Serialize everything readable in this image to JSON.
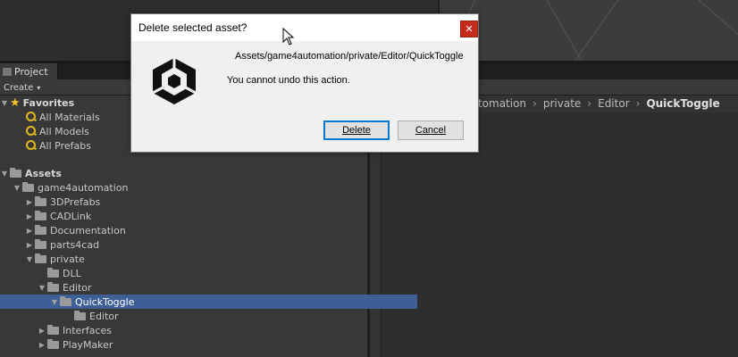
{
  "project_tab": {
    "label": "Project"
  },
  "toolbar": {
    "create_label": "Create",
    "create_arrow": "▾"
  },
  "breadcrumb": {
    "items": [
      "automation",
      "private",
      "Editor"
    ],
    "current": "QuickToggle",
    "separator": "›"
  },
  "tree": {
    "favorites": {
      "label": "Favorites",
      "items": [
        "All Materials",
        "All Models",
        "All Prefabs"
      ]
    },
    "assets": {
      "label": "Assets"
    },
    "game4automation": "game4automation",
    "children": [
      "3DPrefabs",
      "CADLink",
      "Documentation",
      "parts4cad"
    ],
    "private": "private",
    "dll": "DLL",
    "editor": "Editor",
    "quicktoggle": "QuickToggle",
    "quicktoggle_editor": "Editor",
    "interfaces": "Interfaces",
    "playmaker": "PlayMaker"
  },
  "dialog": {
    "title": "Delete selected asset?",
    "close_glyph": "✕",
    "path": "Assets/game4automation/private/Editor/QuickToggle",
    "message": "You cannot undo this action.",
    "delete_label": "Delete",
    "cancel_label": "Cancel"
  },
  "colors": {
    "selection": "#3e5f96",
    "close_button": "#c42b1c",
    "default_button_border": "#0078d7",
    "favorite_star": "#f0c020"
  }
}
